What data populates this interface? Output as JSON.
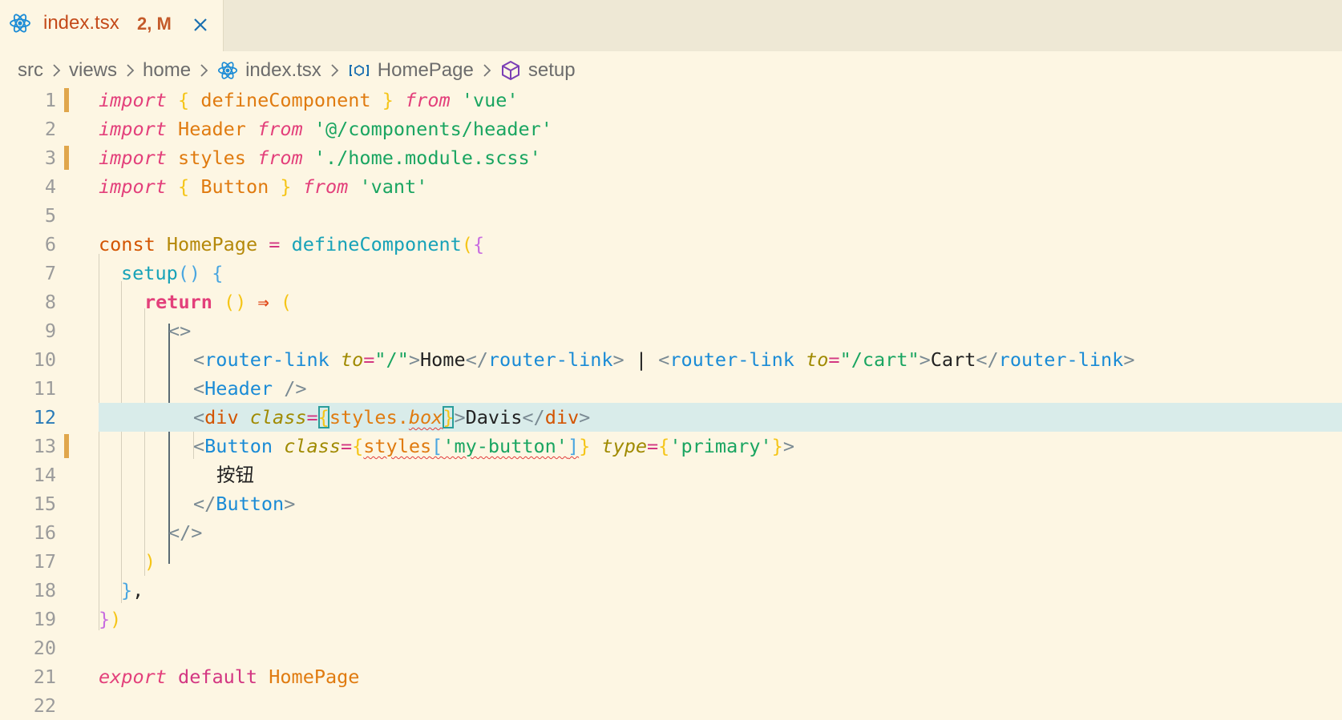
{
  "tab": {
    "filename": "index.tsx",
    "status": "2, M"
  },
  "breadcrumb": [
    "src",
    "views",
    "home",
    "index.tsx",
    "HomePage",
    "setup"
  ],
  "active_line": 12,
  "code": {
    "l1": [
      "import",
      "{",
      "defineComponent",
      "}",
      "from",
      "'vue'"
    ],
    "l2": [
      "import",
      "Header",
      "from",
      "'@/components/header'"
    ],
    "l3": [
      "import",
      "styles",
      "from",
      "'./home.module.scss'"
    ],
    "l4": [
      "import",
      "{",
      "Button",
      "}",
      "from",
      "'vant'"
    ],
    "l6": [
      "const",
      "HomePage",
      "=",
      "defineComponent",
      "(",
      "{"
    ],
    "l7": [
      "setup",
      "()",
      "{"
    ],
    "l8": [
      "return",
      "()",
      "⇒",
      "("
    ],
    "l9": [
      "<>"
    ],
    "l10": [
      "<",
      "router-link",
      "to",
      "=",
      "\"/\"",
      ">",
      "Home",
      "</",
      "router-link",
      ">",
      "|",
      "<",
      "router-link",
      "to",
      "=",
      "\"/cart\"",
      ">",
      "Cart",
      "</",
      "router-link",
      ">"
    ],
    "l11": [
      "<",
      "Header",
      "/>"
    ],
    "l12": [
      "<",
      "div",
      "class",
      "=",
      "{",
      "styles",
      ".",
      "box",
      "}",
      ">",
      "Davis",
      "</",
      "div",
      ">"
    ],
    "l13": [
      "<",
      "Button",
      "class",
      "=",
      "{",
      "styles",
      "[",
      "'my-button'",
      "]",
      "}",
      "type",
      "=",
      "{",
      "'primary'",
      "}",
      ">"
    ],
    "l14": [
      "按钮"
    ],
    "l15": [
      "</",
      "Button",
      ">"
    ],
    "l16": [
      "</>"
    ],
    "l17": [
      ")"
    ],
    "l18": [
      "}",
      ","
    ],
    "l19": [
      "}",
      ")"
    ],
    "l21": [
      "export",
      "default",
      "HomePage"
    ]
  },
  "line_numbers": [
    "1",
    "2",
    "3",
    "4",
    "5",
    "6",
    "7",
    "8",
    "9",
    "10",
    "11",
    "12",
    "13",
    "14",
    "15",
    "16",
    "17",
    "18",
    "19",
    "20",
    "21",
    "22"
  ]
}
